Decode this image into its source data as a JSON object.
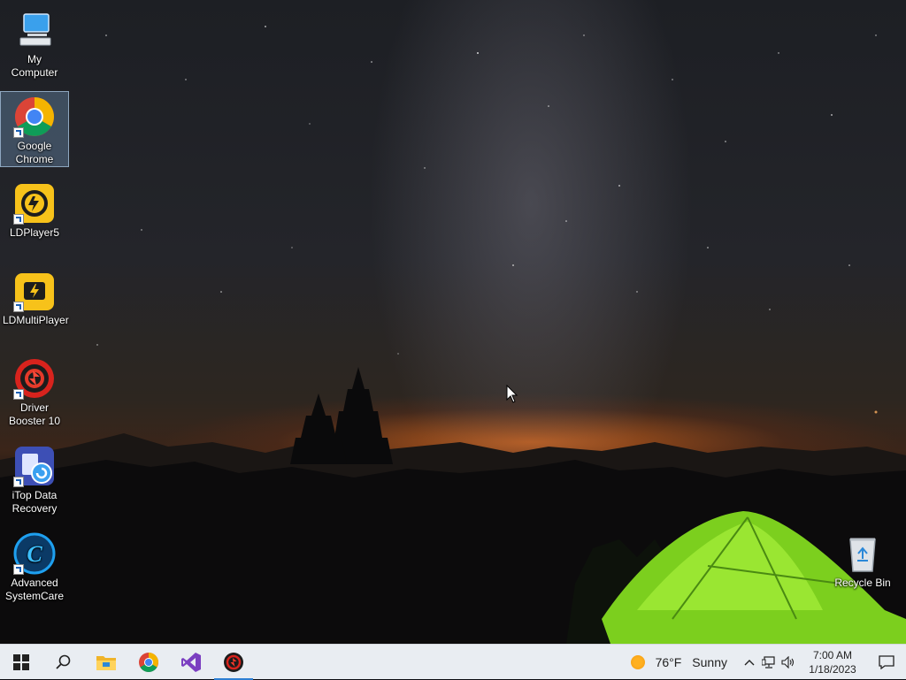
{
  "desktop": {
    "icons": [
      {
        "label": "My Computer"
      },
      {
        "label": "Google Chrome"
      },
      {
        "label": "LDPlayer5"
      },
      {
        "label": "LDMultiPlayer"
      },
      {
        "label": "Driver Booster 10"
      },
      {
        "label": "iTop Data Recovery"
      },
      {
        "label": "Advanced SystemCare"
      },
      {
        "label": "Recycle Bin"
      }
    ]
  },
  "taskbar": {
    "pinned": [
      "start-icon",
      "search-icon",
      "file-explorer-icon",
      "chrome-icon",
      "visual-studio-icon",
      "driver-booster-icon"
    ],
    "weather": {
      "temp": "76°F",
      "condition": "Sunny"
    },
    "clock": {
      "time": "7:00 AM",
      "date": "1/18/2023"
    }
  },
  "colors": {
    "taskbar_bg": "#e9edf2",
    "active_indicator": "#2d7fd3",
    "selection": "#78a0c8"
  }
}
